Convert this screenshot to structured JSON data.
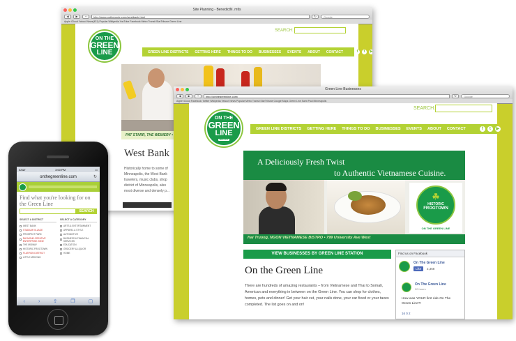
{
  "back_window": {
    "title": "Site Planning - BenedictN. mtls",
    "url": "http://www.ontheroute.com/westbank.html",
    "google_placeholder": "Google",
    "bookmarks": "Apple   iCloud   Yahoo!   News(431)   Popular   Wikipedia   YouTube   Facebook   Metro Transit   StarTribune   Green Line",
    "search_label": "SEARCH:",
    "logo": {
      "on": "ON THE",
      "green": "GREEN",
      "line": "LINE",
      "metro": "METRO"
    },
    "nav": [
      "GREEN LINE DISTRICTS",
      "GETTING HERE",
      "THINGS TO DO",
      "BUSINESSES",
      "EVENTS",
      "ABOUT",
      "CONTACT"
    ],
    "photo_caption": "PAT STARR, THE WEINERY • 4",
    "heading": "West Bank",
    "body": "Historically home to some of Minneapolis, the West Bank travelers, music clubs, shop district of Minneapolis, also most diverse and densely p..."
  },
  "front_window": {
    "title": "Green Line Businesses",
    "url": "http://onthegreenline.com/",
    "google_placeholder": "Google",
    "bookmarks": "Apple  iCloud  Facebook  Twitter  Wikipedia  Yahoo!  News  Popular  Metro Transit  StarTribune  Google Maps  Green Line  Saint Paul  Minneapolis",
    "search_label": "SEARCH:",
    "logo": {
      "on": "ON THE",
      "green": "GREEN",
      "line": "LINE",
      "metro": "METRO"
    },
    "nav": [
      "GREEN LINE DISTRICTS",
      "GETTING HERE",
      "THINGS TO DO",
      "BUSINESSES",
      "EVENTS",
      "ABOUT",
      "CONTACT"
    ],
    "hero_line1": "A Deliciously Fresh Twist",
    "hero_line2": "to Authentic Vietnamese Cuisine.",
    "badge": {
      "historic": "HISTORIC",
      "frogtown": "FROGTOWN",
      "sub": "ON THE GREEN LINE"
    },
    "hero_caption": "Hai Truong, NGON VIETNAMESE BISTRO • 799 University Ave West",
    "view_businesses": "VIEW BUSINESSES BY GREEN LINE STATION",
    "section_title": "On the Green Line",
    "section_body": "There are hundreds of amazing restaurants – from Vietnamese and Thai to Somali, American and everything in between on the Green Line. You can shop for clothes, homes, pets and dinner! Get your hair cut, your nails done, your car fixed or your taxes completed. The list goes on and on!",
    "fb": {
      "header": "Find us on Facebook",
      "page_name": "On The Green Line",
      "like": "Like",
      "likes_count": "2,368",
      "post_name": "On The Green Line",
      "post_time": "20 hours",
      "post_text": "How was YOUR first ride On The Green Line?!",
      "reactions": "16  0  2"
    }
  },
  "phone": {
    "carrier": "AT&T",
    "time": "3:00 PM",
    "url": "onthegreenline.com",
    "find_text": "Find what you're looking for on the Green Line",
    "search_button": "SEARCH",
    "district_header": "SELECT A DISTRICT",
    "category_header": "SELECT A CATEGORY",
    "districts": [
      "WEST BANK",
      "STADIUM VILLAGE",
      "PROSPECT PARK",
      "RAYMOND-CREATIVE ENTERPRISE ZONE",
      "THE MIDWAY",
      "HISTORIC FROGTOWN",
      "FLATIRON DISTRICT",
      "LITTLE MEKONG"
    ],
    "categories": [
      "ARTS & ENTERTAINMENT",
      "APPAREL & STYLE",
      "AUTOMOTIVE",
      "BUSINESS & FINANCIAL SERVICES",
      "EDUCATION",
      "GROCERY & LIQUOR",
      "HOME"
    ]
  },
  "colors": {
    "accent": "#b3d234",
    "green": "#1a9b49",
    "frame": "#c9cf2c"
  }
}
